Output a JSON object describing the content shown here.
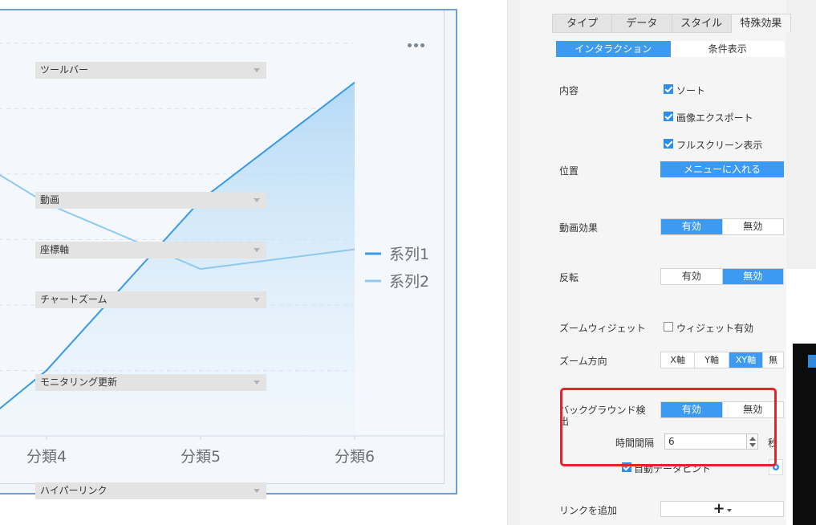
{
  "chart": {
    "legend": [
      {
        "name": "系列1",
        "color": "#3a9ae6"
      },
      {
        "name": "系列2",
        "color": "#8fc9f0"
      }
    ]
  },
  "chart_data": {
    "type": "line",
    "categories": [
      "分類4",
      "分類5",
      "分類6"
    ],
    "series": [
      {
        "name": "系列1",
        "values": [
          20,
          72,
          108
        ],
        "area": true,
        "color": "#3a9ae6"
      },
      {
        "name": "系列2",
        "values": [
          71,
          51,
          57
        ],
        "area": false,
        "color": "#8fc9f0"
      }
    ],
    "ylim": [
      0,
      130
    ],
    "grid": "horizontal dashed",
    "legend_position": "right"
  },
  "panel": {
    "tabs": [
      {
        "label": "タイプ",
        "active": false
      },
      {
        "label": "データ",
        "active": false
      },
      {
        "label": "スタイル",
        "active": false
      },
      {
        "label": "特殊効果",
        "active": true
      }
    ],
    "subtabs": [
      {
        "label": "インタラクション",
        "active": true
      },
      {
        "label": "条件表示",
        "active": false
      }
    ],
    "toolbar": {
      "title": "ツールバー",
      "content_label": "内容",
      "options": [
        {
          "label": "ソート",
          "checked": true
        },
        {
          "label": "画像エクスポート",
          "checked": true
        },
        {
          "label": "フルスクリーン表示",
          "checked": true
        }
      ],
      "position_label": "位置",
      "position_value": "メニューに入れる"
    },
    "animation": {
      "title": "動画",
      "effect_label": "動画効果",
      "on": "有効",
      "off": "無効",
      "selected": "有効"
    },
    "axis": {
      "title": "座標軸",
      "invert_label": "反転",
      "on": "有効",
      "off": "無効",
      "selected": "無効"
    },
    "zoom": {
      "title": "チャートズーム",
      "widget_label": "ズームウィジェット",
      "widget_checkbox": "ウィジェット有効",
      "widget_checked": false,
      "direction_label": "ズーム方向",
      "directions": [
        "X軸",
        "Y軸",
        "XY軸",
        "無"
      ],
      "selected": "XY軸"
    },
    "monitor": {
      "title": "モニタリング更新",
      "bg_check_label_1": "バックグラウンド検",
      "bg_check_label_2": "出",
      "on": "有効",
      "off": "無効",
      "selected": "有効",
      "interval_label": "時間間隔",
      "interval_value": "6",
      "interval_unit": "秒",
      "auto_hint_label": "自動データヒント",
      "auto_hint_checked": true
    },
    "hyperlink": {
      "title": "ハイパーリンク",
      "add_label": "リンクを追加"
    }
  }
}
